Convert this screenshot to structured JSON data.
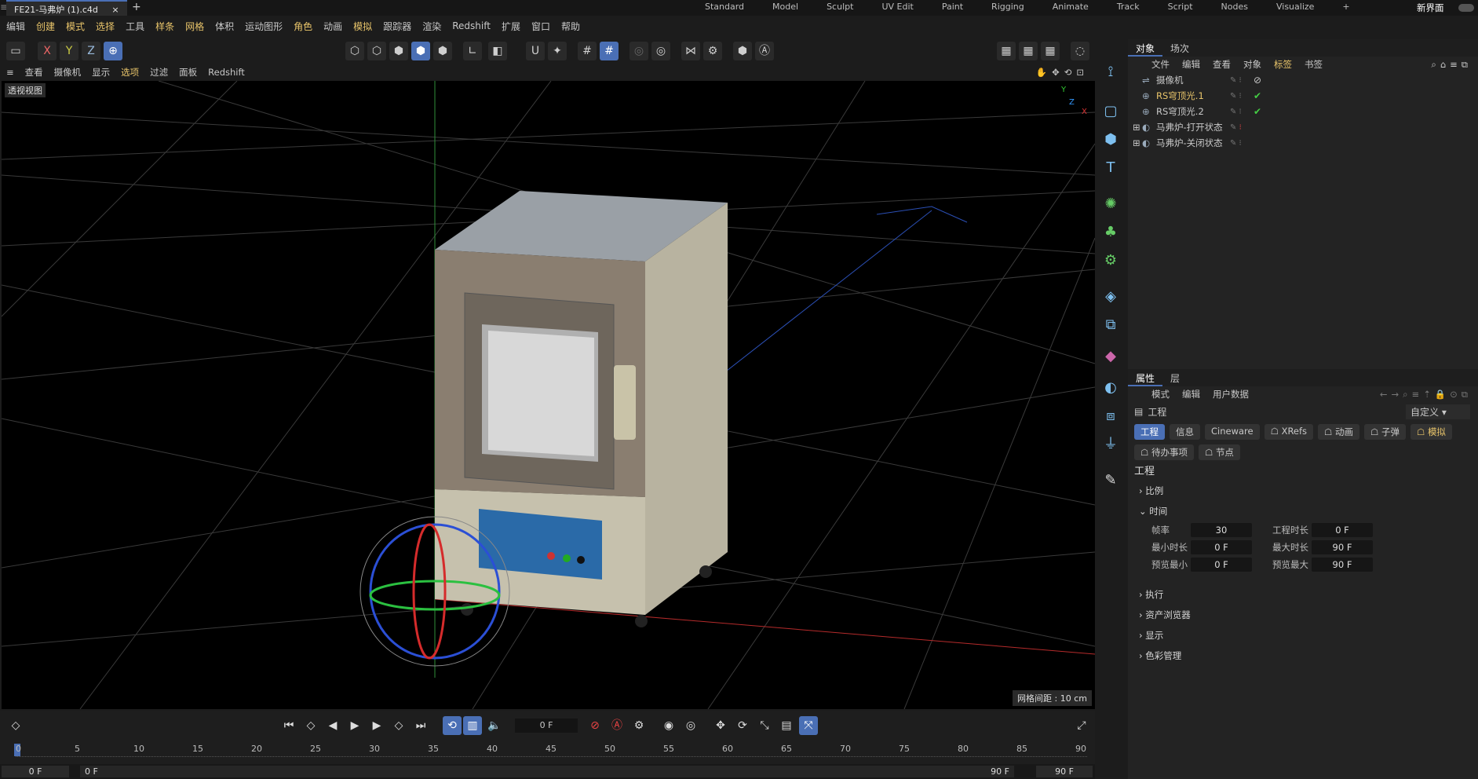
{
  "window": {
    "tab_title": "FE21-马弗炉 (1).c4d",
    "add_tab": "+",
    "layout_new": "新界面"
  },
  "layouts": [
    "Standard",
    "Model",
    "Sculpt",
    "UV Edit",
    "Paint",
    "Rigging",
    "Animate",
    "Track",
    "Script",
    "Nodes",
    "Visualize",
    "+"
  ],
  "menubar": [
    "编辑",
    "创建",
    "模式",
    "选择",
    "工具",
    "样条",
    "网格",
    "体积",
    "运动图形",
    "角色",
    "动画",
    "模拟",
    "跟踪器",
    "渲染",
    "Redshift",
    "扩展",
    "窗口",
    "帮助"
  ],
  "axis_buttons": {
    "x": "X",
    "y": "Y",
    "z": "Z"
  },
  "viewport_menu": [
    "查看",
    "摄像机",
    "显示",
    "选项",
    "过滤",
    "面板",
    "Redshift"
  ],
  "viewport": {
    "label": "透视视图",
    "grid_info": "网格间距 : 10 cm",
    "axis_y": "Y",
    "axis_z": "Z",
    "axis_x": "X"
  },
  "object_panel": {
    "tabs": [
      "对象",
      "场次"
    ],
    "menu": [
      "文件",
      "编辑",
      "查看",
      "对象",
      "标签",
      "书签"
    ],
    "objects": [
      {
        "name": "摄像机",
        "tag": "⊘"
      },
      {
        "name": "RS穹顶光.1",
        "tag": "✔"
      },
      {
        "name": "RS穹顶光.2",
        "tag": "✔"
      },
      {
        "name": "马弗炉-打开状态",
        "tag": ""
      },
      {
        "name": "马弗炉-关闭状态",
        "tag": ""
      }
    ]
  },
  "attr_panel": {
    "tabs": [
      "属性",
      "层"
    ],
    "menu": [
      "模式",
      "编辑",
      "用户数据"
    ],
    "title": "工程",
    "preset": "自定义",
    "chips_row1": [
      "工程",
      "信息",
      "Cineware",
      "XRefs",
      "动画",
      "子弹",
      "模拟"
    ],
    "chips_row2": [
      "待办事项",
      "节点"
    ],
    "section_title": "工程",
    "sections": {
      "scale": "比例",
      "time": "时间",
      "exec": "执行",
      "asset": "资产浏览器",
      "display": "显示",
      "color": "色彩管理"
    },
    "fields": {
      "fps_label": "帧率",
      "fps": "30",
      "proj_len_label": "工程时长",
      "proj_len": "0 F",
      "min_label": "最小时长",
      "min": "0 F",
      "max_label": "最大时长",
      "max": "90 F",
      "pmin_label": "预览最小",
      "pmin": "0 F",
      "pmax_label": "预览最大",
      "pmax": "90 F"
    }
  },
  "timeline": {
    "current_frame": "0 F",
    "ticks": [
      "0",
      "5",
      "10",
      "15",
      "20",
      "25",
      "30",
      "35",
      "40",
      "45",
      "50",
      "55",
      "60",
      "65",
      "70",
      "75",
      "80",
      "85",
      "90"
    ],
    "range_start": "0 F",
    "range_start2": "0 F",
    "range_end": "90 F",
    "range_end2": "90 F"
  }
}
